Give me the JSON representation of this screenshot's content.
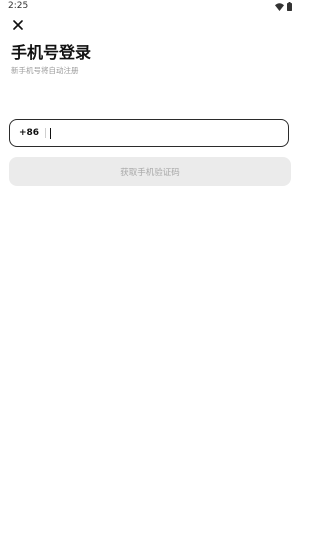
{
  "status_bar": {
    "time": "2:25",
    "icons": [
      "wifi-icon",
      "battery-icon"
    ]
  },
  "header": {
    "close_icon": "close-icon",
    "title": "手机号登录",
    "subtitle": "新手机号将自动注册"
  },
  "phone_form": {
    "country_code": "+86",
    "phone_value": "",
    "get_code_label": "获取手机验证码",
    "button_enabled": false
  },
  "colors": {
    "background": "#ffffff",
    "text_primary": "#111111",
    "text_secondary": "#9a9a9a",
    "field_border": "#2b2b2b",
    "button_disabled_bg": "#ebebeb",
    "button_disabled_text": "#a8a8a8"
  }
}
